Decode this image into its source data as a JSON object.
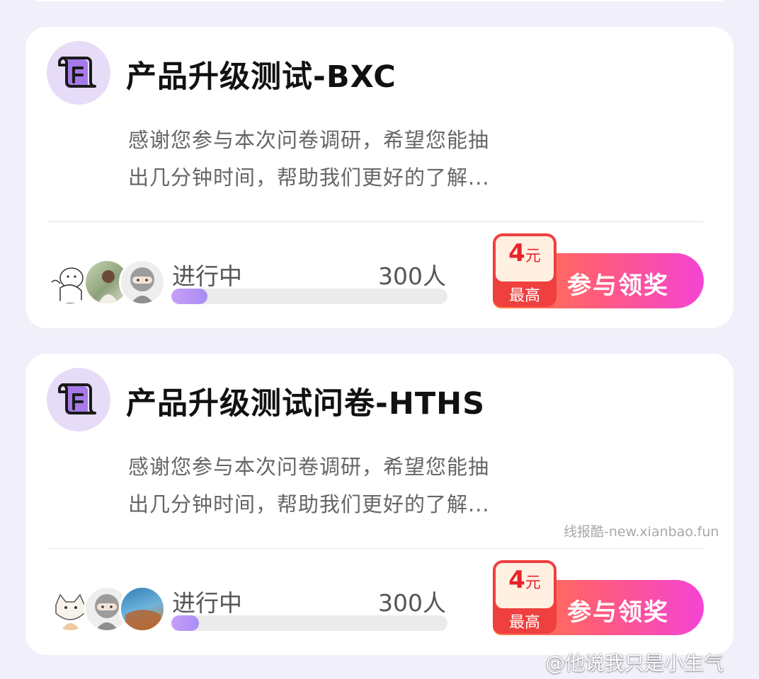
{
  "colors": {
    "page_background": "#f1eff9",
    "card_background": "#ffffff",
    "icon_circle": "#e6dcf8",
    "progress_fill": "#b894f6",
    "button_gradient_start": "#ff7c3a",
    "button_gradient_end": "#f544d6",
    "reward_red": "#ef3f3f"
  },
  "surveys": [
    {
      "icon": "scroll-document-icon",
      "title": "产品升级测试-BXC",
      "desc_line1": "感谢您参与本次问卷调研，希望您能抽",
      "desc_line2": "出几分钟时间，帮助我们更好的了解...",
      "avatars": [
        "cartoon-avatar",
        "photo-avatar",
        "ninja-avatar"
      ],
      "status": "进行中",
      "participants": "300人",
      "progress_fraction": 0.13,
      "reward_amount": "4",
      "reward_unit": "元",
      "reward_caption": "最高",
      "button_label": "参与领奖"
    },
    {
      "icon": "scroll-document-icon",
      "title": "产品升级测试问卷-HTHS",
      "desc_line1": "感谢您参与本次问卷调研，希望您能抽",
      "desc_line2": "出几分钟时间，帮助我们更好的了解...",
      "avatars": [
        "cat-avatar",
        "ninja-avatar",
        "photo-avatar"
      ],
      "status": "进行中",
      "participants": "300人",
      "progress_fraction": 0.1,
      "reward_amount": "4",
      "reward_unit": "元",
      "reward_caption": "最高",
      "button_label": "参与领奖"
    }
  ],
  "watermark": {
    "site": "线报酷-new.xianbao.fun",
    "weibo": "@他说我只是小生气"
  }
}
